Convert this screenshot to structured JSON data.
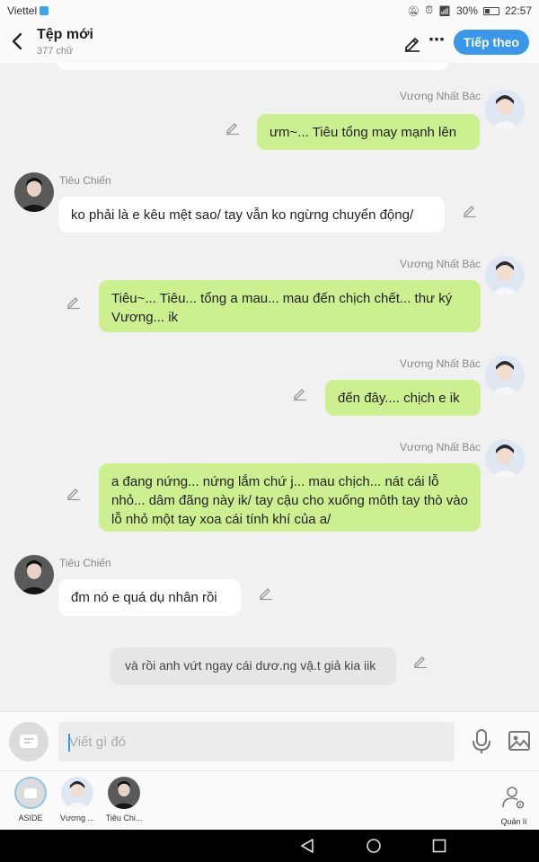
{
  "statusbar": {
    "carrier": "Viettel",
    "battery": "30%",
    "time": "22:57"
  },
  "header": {
    "title": "Tệp mới",
    "subtitle": "377 chữ",
    "next_label": "Tiếp theo"
  },
  "messages": [
    {
      "side": "right",
      "sender": "Vương Nhất Bác",
      "text": "ưm~... Tiêu tổng may mạnh lên"
    },
    {
      "side": "left",
      "sender": "Tiêu Chiến",
      "text": "ko phải là e kêu mệt sao/ tay vẫn ko ngừng chuyển động/"
    },
    {
      "side": "right",
      "sender": "Vương Nhất Bác",
      "text": "Tiêu~... Tiêu... tổng a mau... mau đến chịch chết... thư ký Vương... ik"
    },
    {
      "side": "right",
      "sender": "Vương Nhất Bác",
      "text": "đến đây.... chịch e ik"
    },
    {
      "side": "right",
      "sender": "Vương Nhất Bác",
      "text": "a đang nứng... nứng lắm chứ j... mau chịch... nát cái lỗ nhỏ... dâm đãng này ik/ tay cậu cho xuống môth tay thò vào lỗ nhỏ một tay xoa cái tính khí của a/"
    },
    {
      "side": "left",
      "sender": "Tiêu Chiến",
      "text": "đm nó e quá dụ nhân rồi"
    },
    {
      "side": "center",
      "sender": "",
      "text": "và rồi anh vứt ngay cái dươ.ng vậ.t giả kia iik"
    }
  ],
  "input": {
    "placeholder": "Viết gì đó"
  },
  "characters": [
    {
      "label": "ASIDE"
    },
    {
      "label": "Vương ..."
    },
    {
      "label": "Tiêu Chi..."
    }
  ],
  "manage_label": "Quản lí",
  "colors": {
    "accent": "#3b97ea",
    "right_bubble": "#ccef8f",
    "left_bubble": "#ffffff",
    "background": "#f1f1f1"
  },
  "icons": {
    "back": "chevron-left-icon",
    "edit": "pencil-icon",
    "more": "more-dots-icon",
    "mic": "microphone-icon",
    "image": "image-icon",
    "manage": "user-gear-icon"
  }
}
